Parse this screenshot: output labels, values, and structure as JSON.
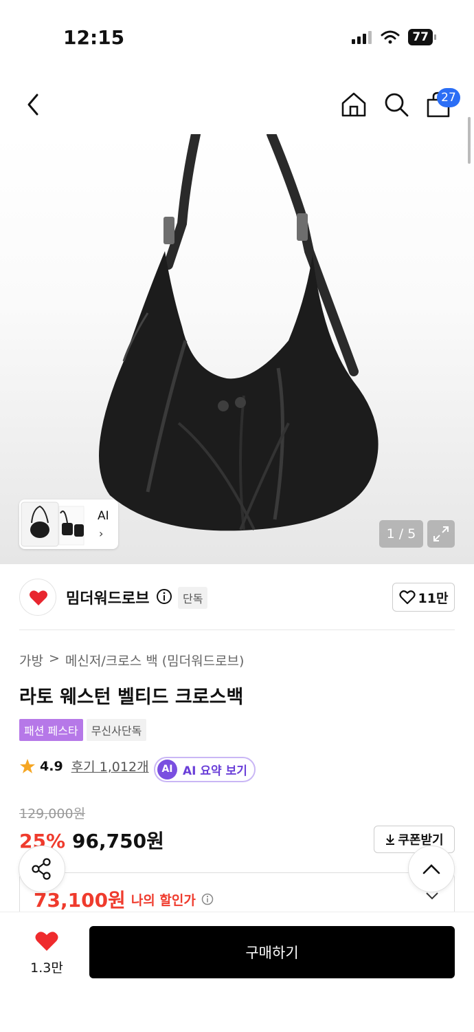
{
  "status_bar": {
    "time": "12:15",
    "battery": "77"
  },
  "nav": {
    "cart_count": "27"
  },
  "gallery": {
    "thumb_label": "AI",
    "counter": "1 / 5"
  },
  "brand": {
    "name": "밈더워드로브",
    "badge": "단독",
    "like_count": "11만"
  },
  "product": {
    "breadcrumb": [
      "가방",
      ">",
      "메신저/크로스 백 (밈더워드로브)"
    ],
    "title": "라토 웨스턴 벨티드 크로스백",
    "tags": [
      "패션 페스타",
      "무신사단독"
    ],
    "rating": "4.9",
    "reviews": "후기 1,012개",
    "ai_summary": {
      "badge": "AI",
      "label": "AI 요약 보기"
    }
  },
  "price": {
    "original": "129,000원",
    "discount": "25%",
    "sale": "96,750원",
    "coupon_label": "쿠폰받기",
    "my_price": "73,100원",
    "my_price_label": "나의 할인가"
  },
  "bottom_bar": {
    "like_count": "1.3만",
    "buy_label": "구매하기"
  },
  "colors": {
    "accent_red": "#ef3b2d",
    "cart_badge": "#2b6ef5",
    "fest_tag": "#b678e8",
    "ai_purple": "#6a3fd8"
  }
}
